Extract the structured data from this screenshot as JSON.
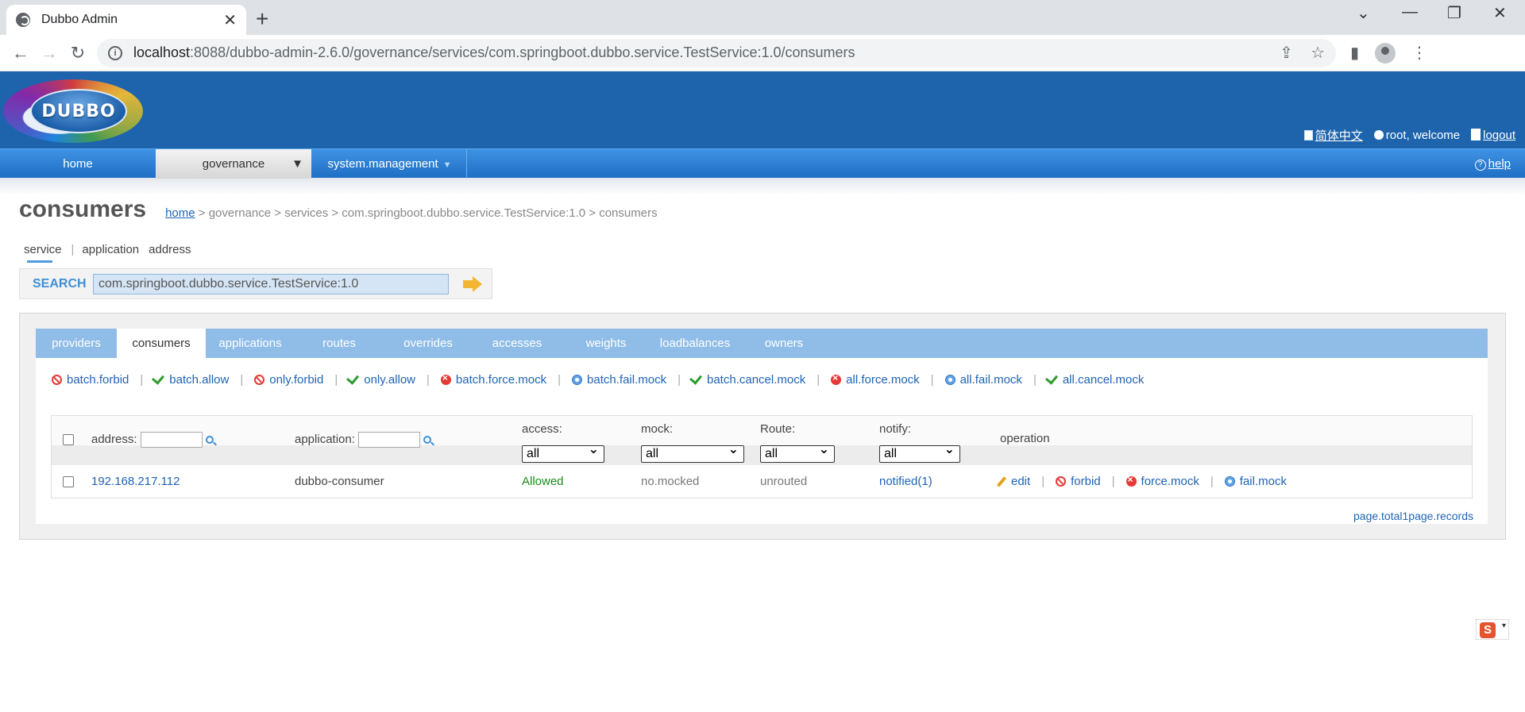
{
  "browser": {
    "tab_title": "Dubbo Admin",
    "tab_close": "✕",
    "new_tab": "+",
    "url_host": "localhost",
    "url_rest": ":8088/dubbo-admin-2.6.0/governance/services/com.springboot.dubbo.service.TestService:1.0/consumers",
    "window_controls": [
      "⌄",
      "—",
      "❐",
      "✕"
    ],
    "nav_buttons": [
      "←",
      "→",
      "↻"
    ],
    "omnibox_icons": [
      "⇪",
      "☆"
    ],
    "chrome_icons": [
      "▮",
      "⋮"
    ]
  },
  "header": {
    "logo_text": "DUBBO",
    "lang_link": "简体中文",
    "welcome": "root, welcome",
    "logout": "logout"
  },
  "mainnav": {
    "items": [
      {
        "label": "home"
      },
      {
        "label": "governance",
        "arrow": "▼"
      },
      {
        "label": "system.management",
        "arrow": "▼"
      }
    ],
    "help_icon": "?",
    "help": "help"
  },
  "page": {
    "title": "consumers",
    "breadcrumb": {
      "home": "home",
      "rest": " > governance > services > com.springboot.dubbo.service.TestService:1.0 > consumers"
    }
  },
  "subtabs": {
    "service": "service",
    "separator": "|",
    "application": "application",
    "address": "address"
  },
  "search": {
    "label": "SEARCH",
    "value": "com.springboot.dubbo.service.TestService:1.0"
  },
  "panel_tabs": [
    "providers",
    "consumers",
    "applications",
    "routes",
    "overrides",
    "accesses",
    "weights",
    "loadbalances",
    "owners"
  ],
  "actions": {
    "batch_forbid": "batch.forbid",
    "batch_allow": "batch.allow",
    "only_forbid": "only.forbid",
    "only_allow": "only.allow",
    "batch_force_mock": "batch.force.mock",
    "batch_fail_mock": "batch.fail.mock",
    "batch_cancel_mock": "batch.cancel.mock",
    "all_force_mock": "all.force.mock",
    "all_fail_mock": "all.fail.mock",
    "all_cancel_mock": "all.cancel.mock",
    "separator": "|"
  },
  "table": {
    "headers": {
      "address": "address:",
      "application": "application:",
      "access": "access:",
      "mock": "mock:",
      "route": "Route:",
      "notify": "notify:",
      "operation": "operation"
    },
    "filters": {
      "access": "all",
      "mock": "all",
      "route": "all",
      "notify": "all"
    },
    "rows": [
      {
        "address": "192.168.217.112",
        "application": "dubbo-consumer",
        "access": "Allowed",
        "mock": "no.mocked",
        "route": "unrouted",
        "notify": "notified(1)",
        "ops": {
          "edit": "edit",
          "forbid": "forbid",
          "force_mock": "force.mock",
          "fail_mock": "fail.mock"
        }
      }
    ],
    "op_separator": "|"
  },
  "pagination": "page.total1page.records",
  "ime": {
    "logo": "S",
    "menu": "▾"
  },
  "colors": {
    "header_blue": "#1d64ad",
    "nav_blue": "#2f80d4",
    "panel_tab_blue": "#8fbde8",
    "link_blue": "#1f63b3",
    "allowed_green": "#1a8a1a"
  }
}
